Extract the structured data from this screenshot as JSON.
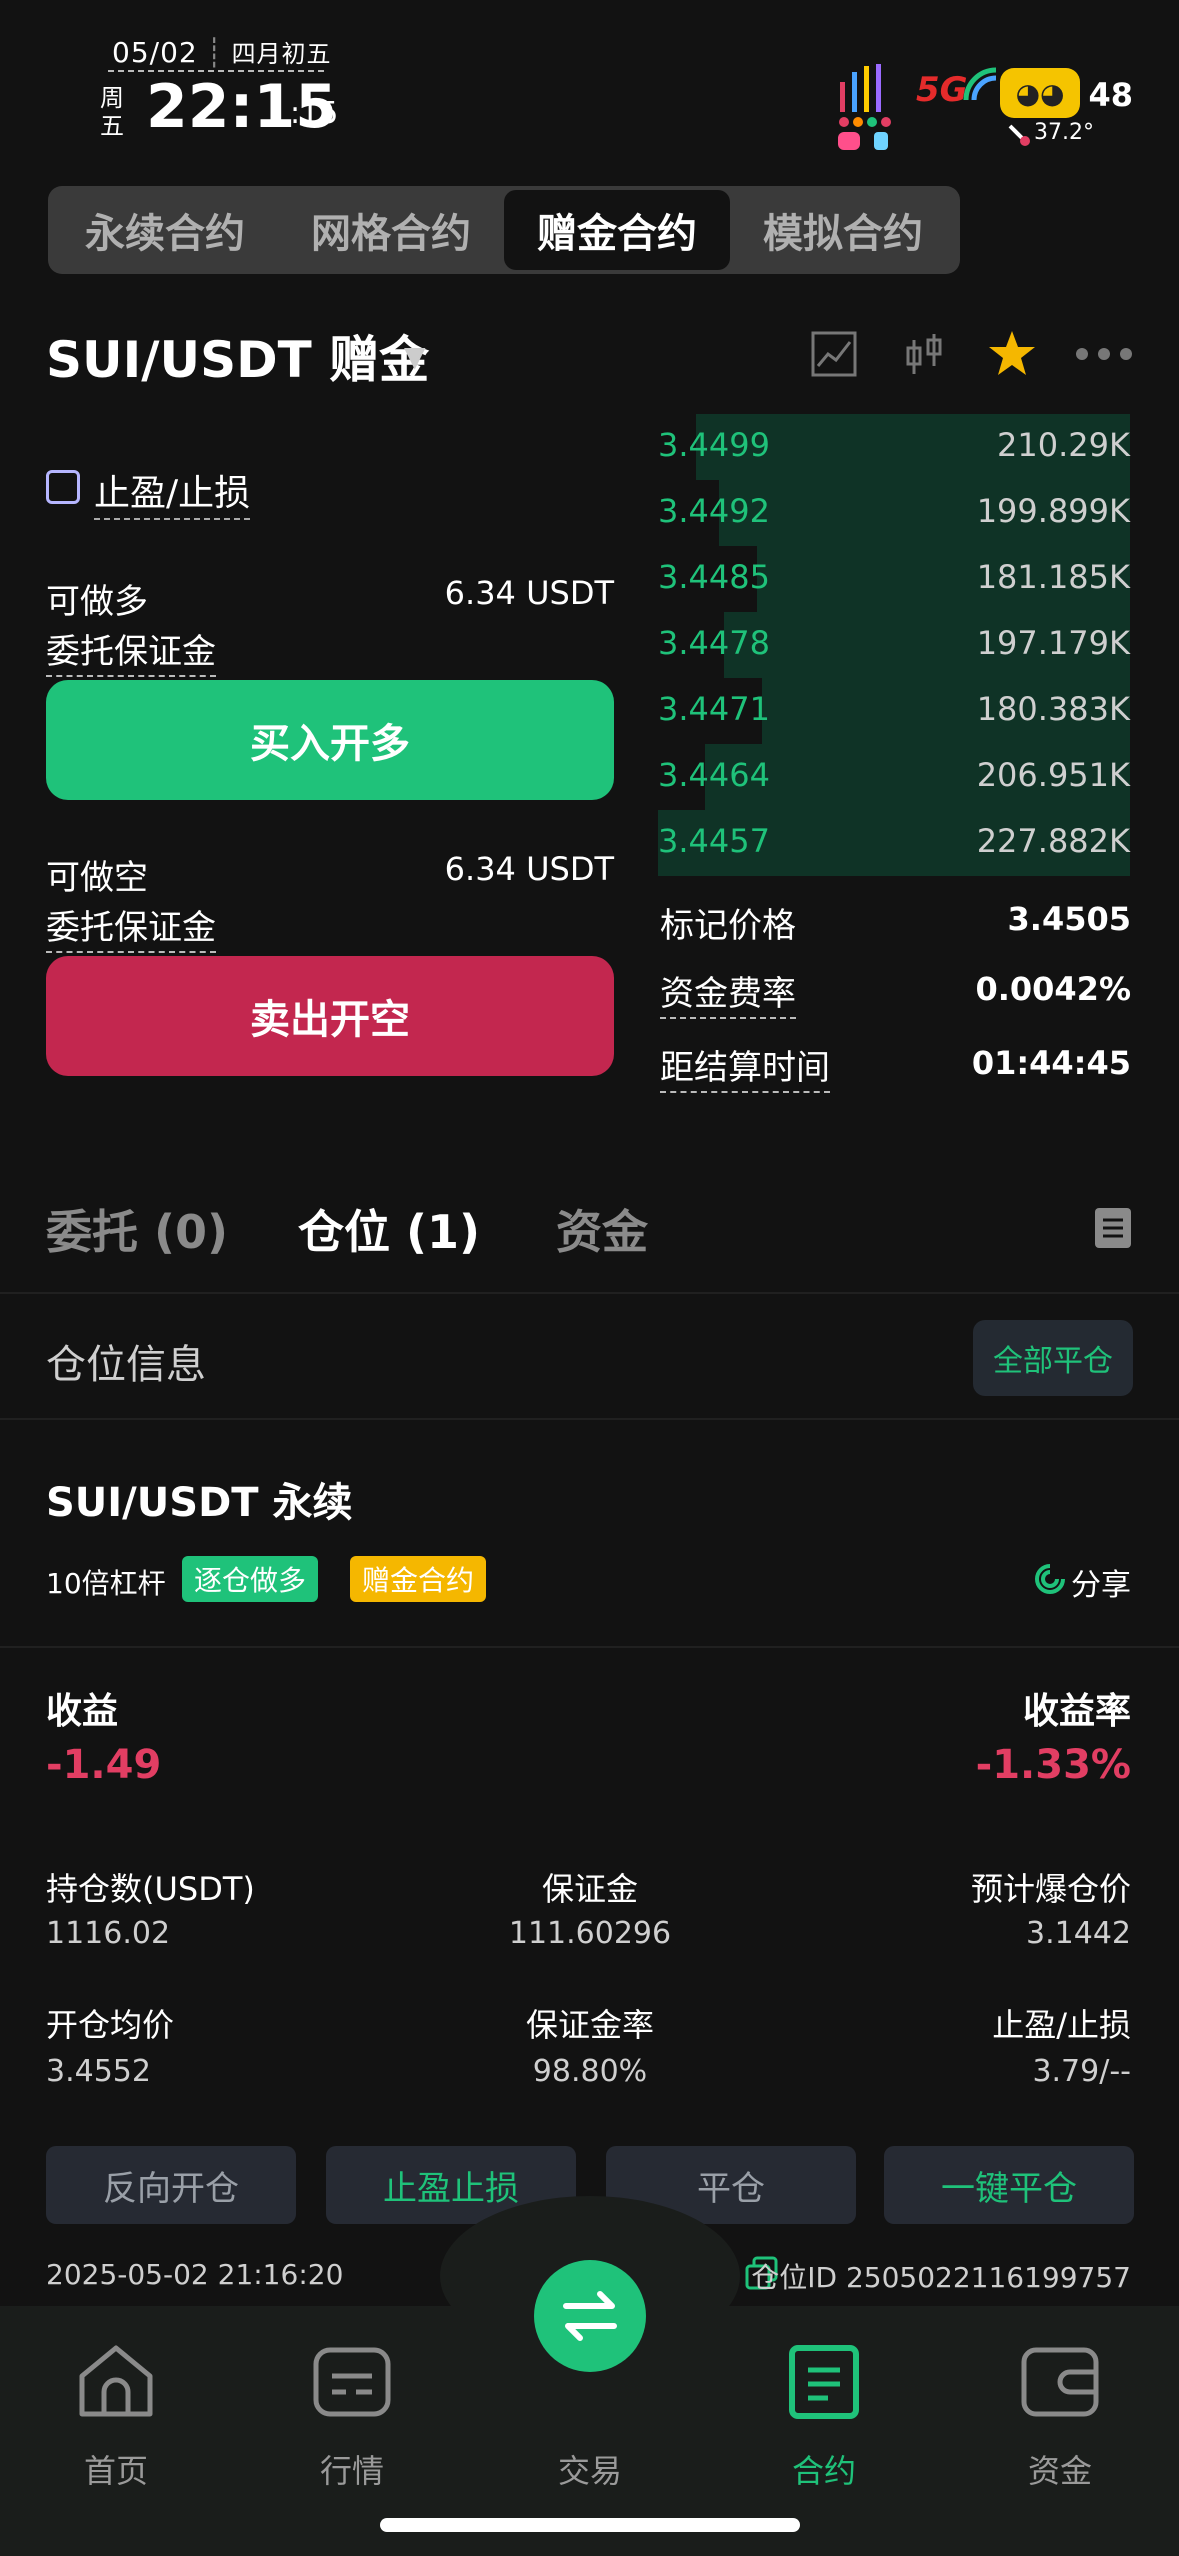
{
  "status_bar": {
    "date": "05/02",
    "lunar": "四月初五",
    "weekday": "周五",
    "time": "22:15",
    "seconds": ":15",
    "signal": "5G",
    "temperature": "37.2°",
    "battery": "48"
  },
  "mode_tabs": [
    "永续合约",
    "网格合约",
    "赠金合约",
    "模拟合约"
  ],
  "mode_tab_active": 2,
  "header": {
    "pair": "SUI/USDT 赠金"
  },
  "form": {
    "tpsl_label": "止盈/止损",
    "long_available_label": "可做多",
    "long_available_value": "6.34 USDT",
    "long_margin_label": "委托保证金",
    "buy_button": "买入开多",
    "short_available_label": "可做空",
    "short_available_value": "6.34 USDT",
    "short_margin_label": "委托保证金",
    "sell_button": "卖出开空"
  },
  "order_book": [
    {
      "price": "3.4499",
      "qty": "210.29K",
      "depth": 0.92
    },
    {
      "price": "3.4492",
      "qty": "199.899K",
      "depth": 0.87
    },
    {
      "price": "3.4485",
      "qty": "181.185K",
      "depth": 0.79
    },
    {
      "price": "3.4478",
      "qty": "197.179K",
      "depth": 0.86
    },
    {
      "price": "3.4471",
      "qty": "180.383K",
      "depth": 0.78
    },
    {
      "price": "3.4464",
      "qty": "206.951K",
      "depth": 0.9
    },
    {
      "price": "3.4457",
      "qty": "227.882K",
      "depth": 1.0
    }
  ],
  "market_info": {
    "mark_price_label": "标记价格",
    "mark_price": "3.4505",
    "funding_label": "资金费率",
    "funding": "0.0042%",
    "settle_label": "距结算时间",
    "settle": "01:44:45"
  },
  "position_tabs": [
    "委托 (0)",
    "仓位 (1)",
    "资金"
  ],
  "position_tab_active": 1,
  "position_section": {
    "title": "仓位信息",
    "close_all": "全部平仓"
  },
  "position": {
    "title": "SUI/USDT 永续",
    "leverage": "10倍杠杆",
    "tag_mode": "逐仓做多",
    "tag_type": "赠金合约",
    "share": "分享",
    "pnl_label": "收益",
    "pnl": "-1.49",
    "roe_label": "收益率",
    "roe": "-1.33%",
    "size_label": "持仓数(USDT)",
    "size": "1116.02",
    "margin_label": "保证金",
    "margin": "111.60296",
    "liq_label": "预计爆仓价",
    "liq": "3.1442",
    "entry_label": "开仓均价",
    "entry": "3.4552",
    "margin_ratio_label": "保证金率",
    "margin_ratio": "98.80%",
    "tpsl_label": "止盈/止损",
    "tpsl": "3.79/--",
    "actions": [
      "反向开仓",
      "止盈止损",
      "平仓",
      "一键平仓"
    ],
    "open_time": "2025-05-02 21:16:20",
    "position_id": "仓位ID 2505022116199757"
  },
  "bottom_nav": {
    "items": [
      "首页",
      "行情",
      "交易",
      "合约",
      "资金"
    ],
    "active": 3
  },
  "colors": {
    "green": "#1fc27a",
    "red": "#e23e63",
    "sell_button": "#c3274f",
    "background": "#121212"
  }
}
